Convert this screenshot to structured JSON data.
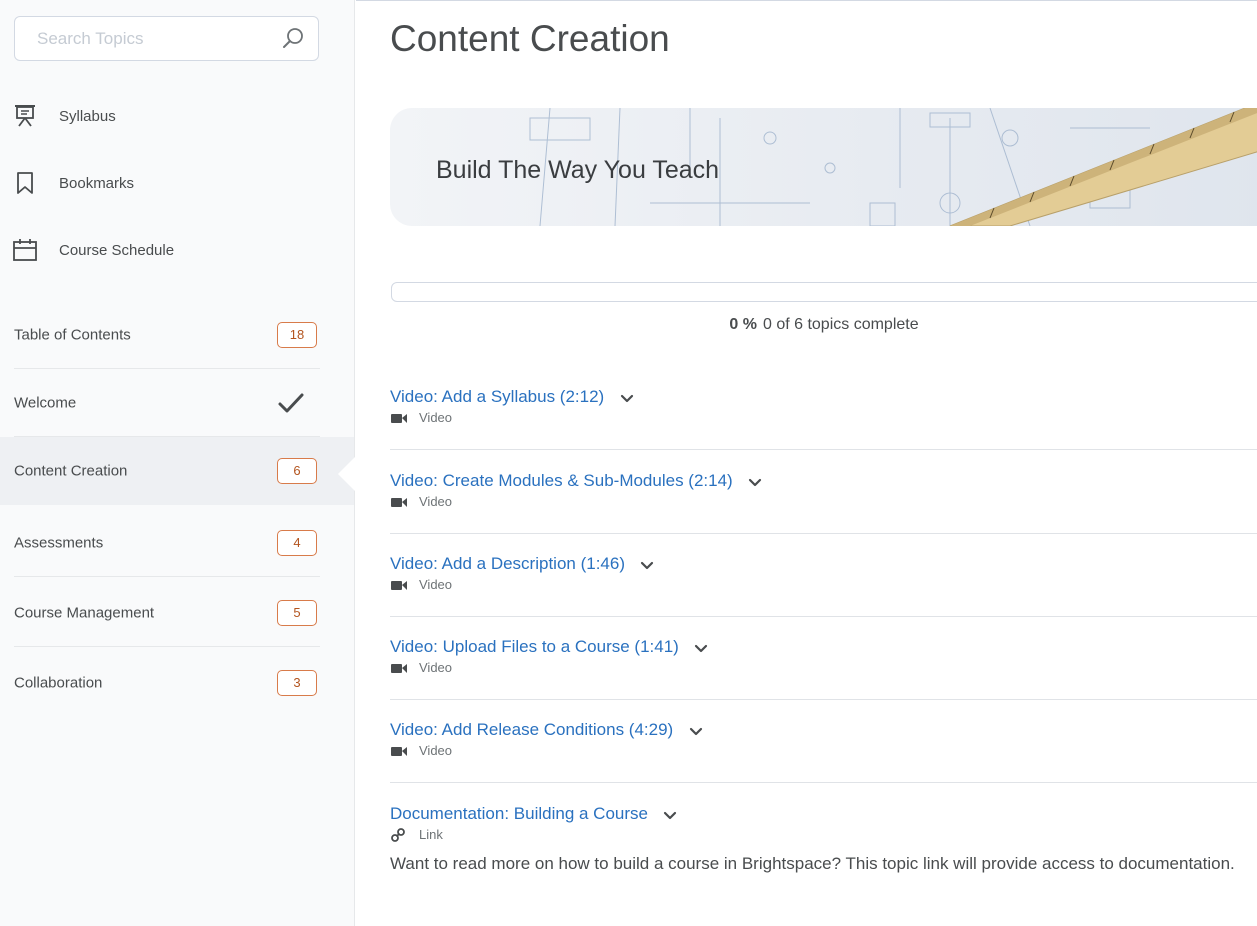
{
  "search": {
    "placeholder": "Search Topics"
  },
  "tools": [
    {
      "label": "Syllabus",
      "icon": "presentation-board-icon"
    },
    {
      "label": "Bookmarks",
      "icon": "bookmark-icon"
    },
    {
      "label": "Course Schedule",
      "icon": "calendar-icon"
    }
  ],
  "toc": [
    {
      "label": "Table of Contents",
      "badge": "18"
    },
    {
      "label": "Welcome",
      "badge": "",
      "icon": "checkmark-icon"
    },
    {
      "label": "Content Creation",
      "badge": "6",
      "active": true
    },
    {
      "label": "Assessments",
      "badge": "4"
    },
    {
      "label": "Course Management",
      "badge": "5"
    },
    {
      "label": "Collaboration",
      "badge": "3"
    }
  ],
  "main": {
    "title": "Content Creation",
    "banner_text": "Build The Way You Teach",
    "progress": {
      "percent_label": "0 %",
      "text": "0 of 6 topics complete",
      "fraction": 0
    },
    "topics": [
      {
        "title": "Video: Add a Syllabus (2:12)",
        "type": "Video",
        "icon": "video-camera-icon"
      },
      {
        "title": "Video: Create Modules & Sub-Modules (2:14)",
        "type": "Video",
        "icon": "video-camera-icon"
      },
      {
        "title": "Video: Add a Description (1:46)",
        "type": "Video",
        "icon": "video-camera-icon"
      },
      {
        "title": "Video: Upload Files to a Course (1:41)",
        "type": "Video",
        "icon": "video-camera-icon"
      },
      {
        "title": "Video: Add Release Conditions (4:29)",
        "type": "Video",
        "icon": "video-camera-icon"
      },
      {
        "title": "Documentation: Building a Course",
        "type": "Link",
        "icon": "link-icon",
        "description": "Want to read more on how to build a course in Brightspace? This topic link will provide access to documentation."
      }
    ]
  },
  "colors": {
    "link_blue": "#2a71bf",
    "badge_orange": "#d87b4a",
    "text_gray": "#494c4e",
    "sidebar_bg": "#f9fafb",
    "active_bg": "#eef0f3"
  }
}
